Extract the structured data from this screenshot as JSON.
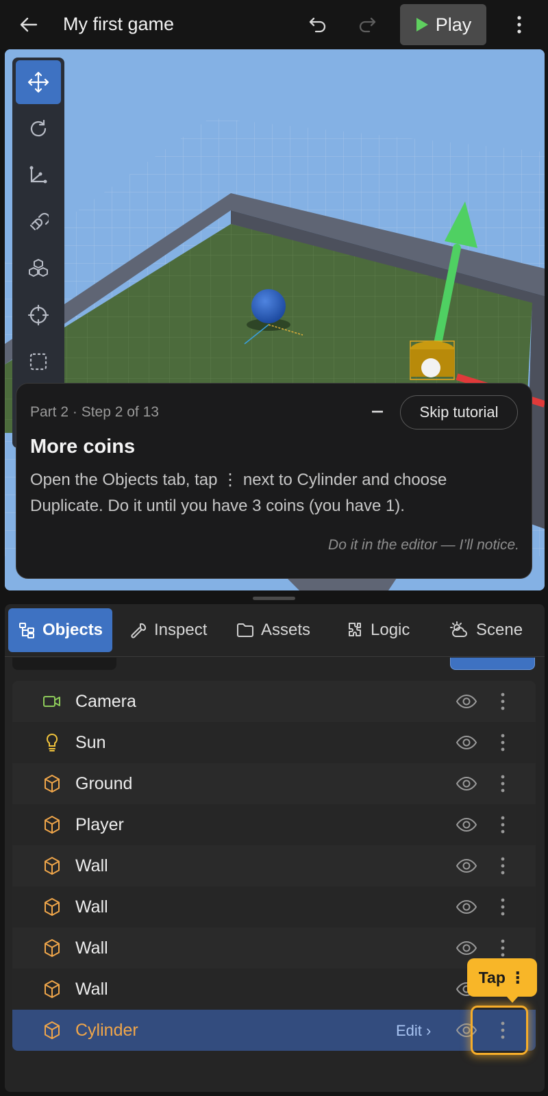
{
  "header": {
    "title": "My first game",
    "play_label": "Play",
    "icons": {
      "back": "arrow-left-icon",
      "undo": "undo-icon",
      "redo": "redo-icon",
      "more": "more-vertical-icon"
    }
  },
  "toolbar": {
    "tools": [
      {
        "icon": "move-icon",
        "active": true
      },
      {
        "icon": "rotate-icon",
        "active": false
      },
      {
        "icon": "scale-icon",
        "active": false
      },
      {
        "icon": "magnet-icon",
        "active": false
      },
      {
        "icon": "objects-cube-icon",
        "active": false
      },
      {
        "icon": "focus-target-icon",
        "active": false
      },
      {
        "icon": "select-box-icon",
        "active": false
      }
    ]
  },
  "tutorial": {
    "step": "Part 2 · Step 2 of 13",
    "skip_label": "Skip tutorial",
    "heading": "More coins",
    "body": "Open the Objects tab, tap ⋮ next to Cylinder and choose Duplicate. Do it until you have 3 coins (you have 1).",
    "hint": "Do it in the editor — I’ll notice."
  },
  "tabs": [
    {
      "label": "Objects",
      "icon": "objects-tree-icon",
      "active": true
    },
    {
      "label": "Inspect",
      "icon": "wrench-icon",
      "active": false
    },
    {
      "label": "Assets",
      "icon": "folder-icon",
      "active": false
    },
    {
      "label": "Logic",
      "icon": "puzzle-icon",
      "active": false
    },
    {
      "label": "Scene",
      "icon": "weather-icon",
      "active": false
    }
  ],
  "objects": [
    {
      "name": "Camera",
      "icon": "camera-icon"
    },
    {
      "name": "Sun",
      "icon": "lightbulb-icon"
    },
    {
      "name": "Ground",
      "icon": "cube-icon"
    },
    {
      "name": "Player",
      "icon": "cube-icon"
    },
    {
      "name": "Wall",
      "icon": "cube-icon"
    },
    {
      "name": "Wall",
      "icon": "cube-icon"
    },
    {
      "name": "Wall",
      "icon": "cube-icon"
    },
    {
      "name": "Wall",
      "icon": "cube-icon"
    },
    {
      "name": "Cylinder",
      "icon": "cube-icon",
      "selected": true,
      "edit_label": "Edit ›"
    }
  ],
  "callout": {
    "label": "Tap ⋮"
  },
  "colors": {
    "accent": "#3e72c2",
    "highlight": "#f6ad2a",
    "cube_icon": "#f0a64a",
    "camera_icon": "#8ecb5a",
    "sun_icon": "#f3c53c",
    "play_icon": "#5fd05f"
  }
}
